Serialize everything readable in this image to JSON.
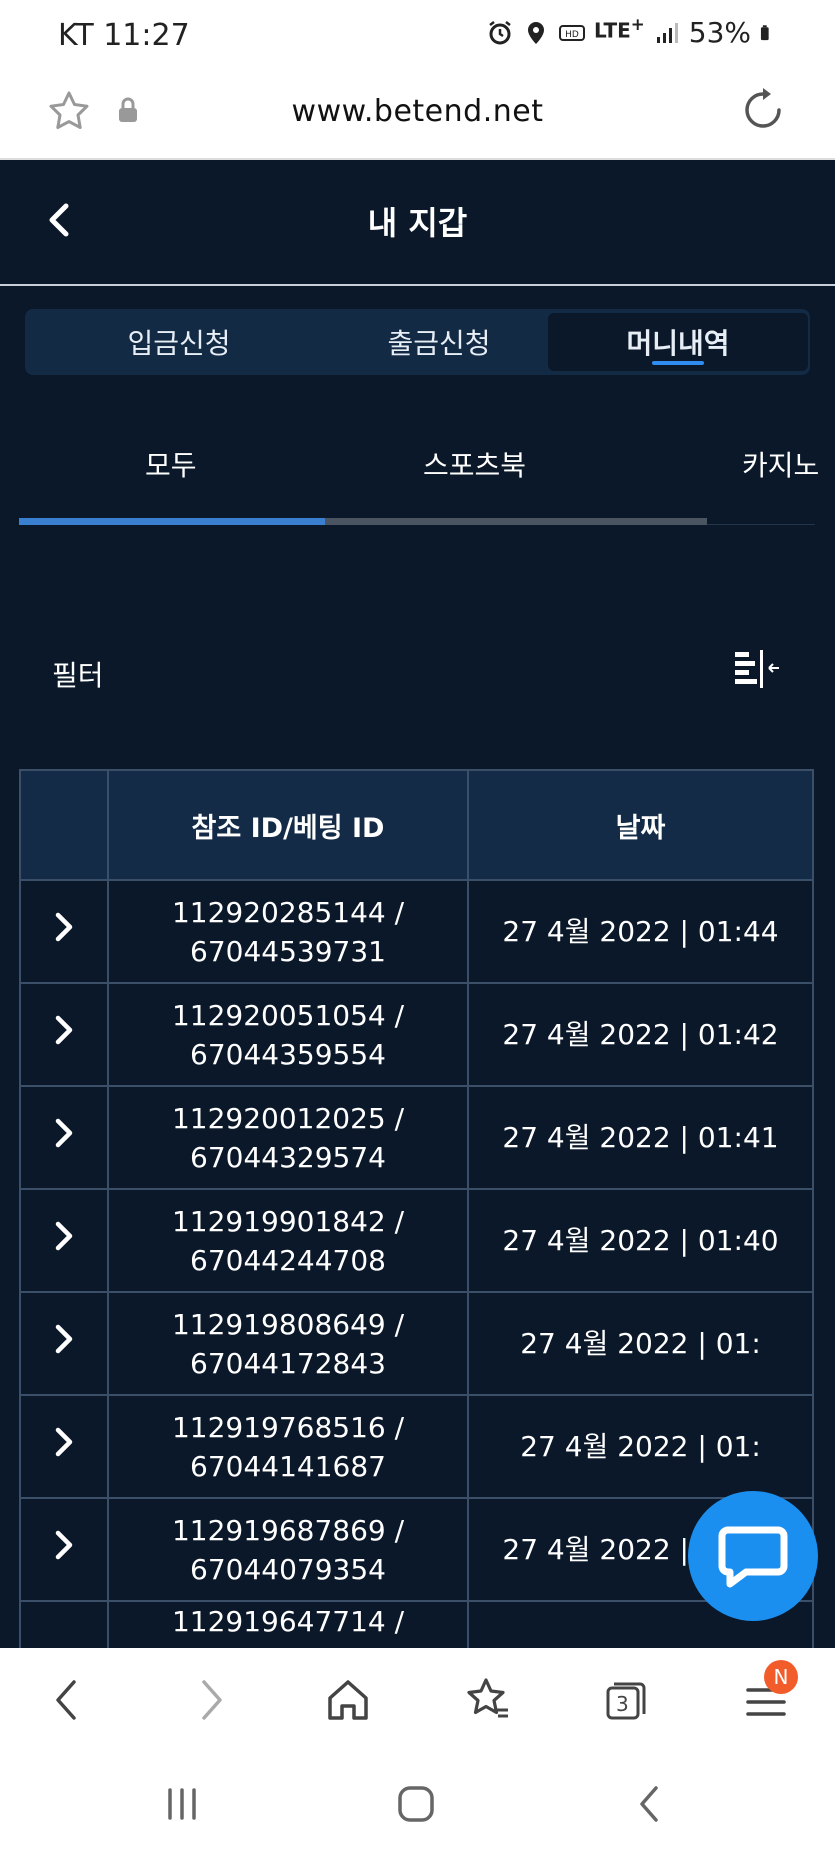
{
  "status_bar": {
    "carrier_time": "KT 11:27",
    "network": "LTE",
    "network_plus": "+",
    "battery": "53%",
    "icons": [
      "alarm-icon",
      "location-icon",
      "hd-icon",
      "lte-icon",
      "signal-icon",
      "battery-icon"
    ]
  },
  "browser": {
    "url": "www.betend.net"
  },
  "page": {
    "title": "내 지갑"
  },
  "segment_tabs": [
    {
      "label": "입금신청",
      "active": false
    },
    {
      "label": "출금신청",
      "active": false
    },
    {
      "label": "머니내역",
      "active": true
    }
  ],
  "sub_tabs": [
    {
      "label": "모두",
      "active": true
    },
    {
      "label": "스포츠북",
      "active": false
    },
    {
      "label": "카지노",
      "active": false
    }
  ],
  "filter": {
    "label": "필터"
  },
  "table": {
    "headers": [
      "",
      "참조 ID/베팅 ID",
      "날짜"
    ],
    "rows": [
      {
        "ref": "112920285144 /",
        "bet": "67044539731",
        "date": "27 4월 2022 | 01:44"
      },
      {
        "ref": "112920051054 /",
        "bet": "67044359554",
        "date": "27 4월 2022 | 01:42"
      },
      {
        "ref": "112920012025 /",
        "bet": "67044329574",
        "date": "27 4월 2022 | 01:41"
      },
      {
        "ref": "112919901842 /",
        "bet": "67044244708",
        "date": "27 4월 2022 | 01:40"
      },
      {
        "ref": "112919808649 /",
        "bet": "67044172843",
        "date": "27 4월 2022 | 01:"
      },
      {
        "ref": "112919768516 /",
        "bet": "67044141687",
        "date": "27 4월 2022 | 01:"
      },
      {
        "ref": "112919687869 /",
        "bet": "67044079354",
        "date": "27 4월 2022 | 01:38"
      },
      {
        "ref": "112919647714 /",
        "bet": "",
        "date": ""
      }
    ]
  },
  "browser_nav": {
    "tabs_count": "3",
    "menu_badge": "N"
  },
  "colors": {
    "app_bg": "#0b1829",
    "header_cell": "#132b47",
    "accent": "#2f8cf0",
    "chat_button": "#1a8ff0",
    "badge": "#f25c2a"
  }
}
